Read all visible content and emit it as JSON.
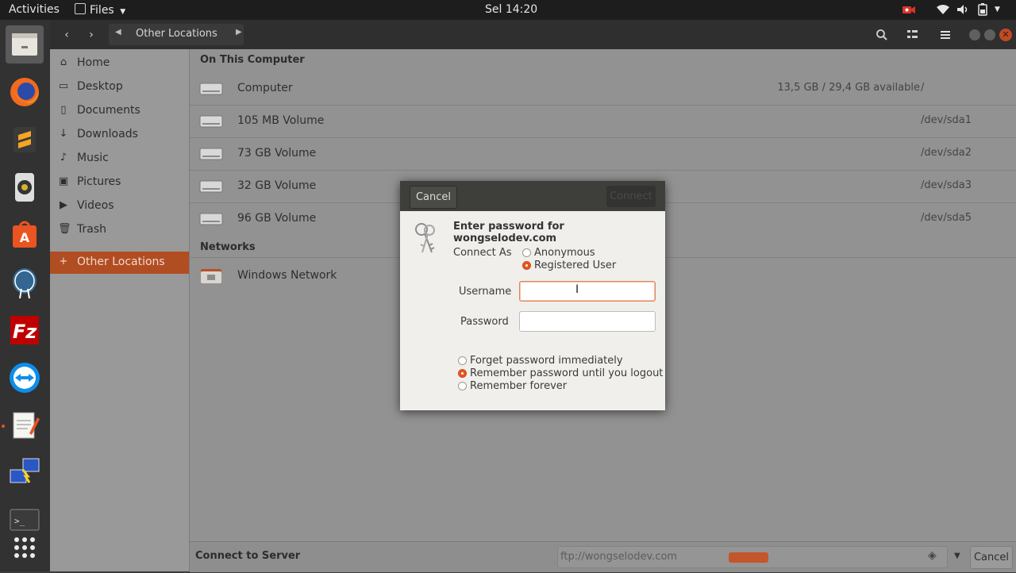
{
  "topbar": {
    "activities": "Activities",
    "app_menu": "Files",
    "clock": "Sel 14:20"
  },
  "headerbar": {
    "location": "Other Locations"
  },
  "sidebar": {
    "items": [
      {
        "label": "Home",
        "icon": "home-icon"
      },
      {
        "label": "Desktop",
        "icon": "desktop-icon"
      },
      {
        "label": "Documents",
        "icon": "documents-icon"
      },
      {
        "label": "Downloads",
        "icon": "downloads-icon"
      },
      {
        "label": "Music",
        "icon": "music-icon"
      },
      {
        "label": "Pictures",
        "icon": "pictures-icon"
      },
      {
        "label": "Videos",
        "icon": "videos-icon"
      },
      {
        "label": "Trash",
        "icon": "trash-icon"
      },
      {
        "label": "Other Locations",
        "icon": "plus-icon"
      }
    ]
  },
  "content": {
    "on_this_computer": "On This Computer",
    "networks": "Networks",
    "volumes": [
      {
        "name": "Computer",
        "available": "13,5 GB / 29,4 GB available",
        "path": "/"
      },
      {
        "name": "105 MB Volume",
        "available": "",
        "path": "/dev/sda1"
      },
      {
        "name": "73 GB Volume",
        "available": "",
        "path": "/dev/sda2"
      },
      {
        "name": "32 GB Volume",
        "available": "",
        "path": "/dev/sda3"
      },
      {
        "name": "96 GB Volume",
        "available": "",
        "path": "/dev/sda5"
      }
    ],
    "network_items": [
      {
        "name": "Windows Network"
      }
    ]
  },
  "bottombar": {
    "label": "Connect to Server",
    "server_address": "ftp://wongselodev.com",
    "cancel": "Cancel"
  },
  "dialog": {
    "cancel": "Cancel",
    "connect": "Connect",
    "title": "Enter password for wongselodev.com",
    "connect_as_label": "Connect As",
    "anonymous": "Anonymous",
    "registered_user": "Registered User",
    "username_label": "Username",
    "password_label": "Password",
    "username_value": "",
    "password_value": "",
    "forget_immediately": "Forget password immediately",
    "remember_logout": "Remember password until you logout",
    "remember_forever": "Remember forever"
  },
  "colors": {
    "accent": "#e95420",
    "sidebar_active": "#b14d22"
  }
}
